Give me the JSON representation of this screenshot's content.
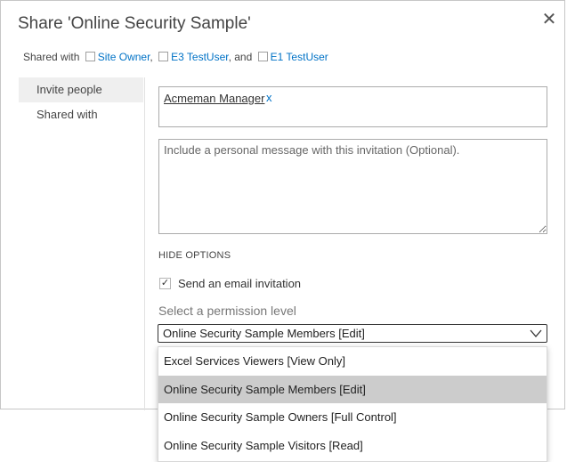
{
  "dialog": {
    "title": "Share 'Online Security Sample'",
    "close_icon": "✕"
  },
  "shared_with": {
    "prefix": "Shared with",
    "users": [
      "Site Owner",
      "E3 TestUser",
      "E1 TestUser"
    ],
    "sep1": ",",
    "sep2": ", and"
  },
  "nav": {
    "items": [
      {
        "label": "Invite people",
        "active": true
      },
      {
        "label": "Shared with",
        "active": false
      }
    ]
  },
  "invite": {
    "person": "Acmeman Manager",
    "remove": "x",
    "message_placeholder": "Include a personal message with this invitation (Optional)."
  },
  "options": {
    "hide_label": "HIDE OPTIONS",
    "send_email_label": "Send an email invitation",
    "send_email_checked": "✓",
    "permission_label": "Select a permission level",
    "permission_value": "Online Security Sample Members [Edit]",
    "permission_options": [
      "Excel Services Viewers [View Only]",
      "Online Security Sample Members [Edit]",
      "Online Security Sample Owners [Full Control]",
      "Online Security Sample Visitors [Read]"
    ],
    "selected_index": 1
  },
  "colors": {
    "link": "#0072c6",
    "selected_option_bg": "#cccccc",
    "nav_active_bg": "#efefef"
  }
}
